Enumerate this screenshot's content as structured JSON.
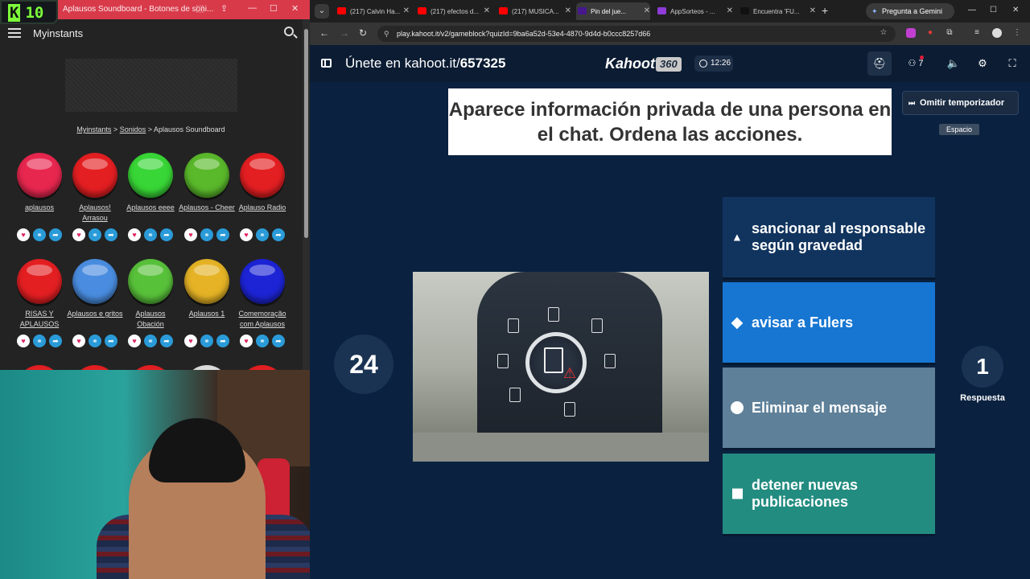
{
  "left_window": {
    "title": "Aplausos Soundboard - Botones de soni...",
    "counter_badge": "10",
    "app_title": "Myinstants",
    "breadcrumb": {
      "home": "Myinstants",
      "sep1": ">",
      "sounds": "Sonidos",
      "sep2": ">",
      "current": "Aplausos Soundboard"
    },
    "sounds": [
      {
        "label": "aplausos",
        "color": "#e8274f"
      },
      {
        "label": "Aplausos! Arrasou",
        "color": "#e41f22"
      },
      {
        "label": "Aplausos eeee",
        "color": "#38d636"
      },
      {
        "label": "Aplausos - Cheer",
        "color": "#5ab82b"
      },
      {
        "label": "Aplauso Radio",
        "color": "#e41f22"
      },
      {
        "label": "RISAS Y APLAUSOS",
        "color": "#e41f22"
      },
      {
        "label": "Aplausos e gritos",
        "color": "#4a8de0"
      },
      {
        "label": "Aplausos Obación",
        "color": "#58c13a"
      },
      {
        "label": "Aplausos 1",
        "color": "#e5b325"
      },
      {
        "label": "Comemoração com Aplausos",
        "color": "#1d24d6"
      }
    ]
  },
  "browser": {
    "tabs": [
      {
        "label": "(217) Calvin Ha...",
        "icon_color": "#ff0000"
      },
      {
        "label": "(217) efectos d...",
        "icon_color": "#ff0000"
      },
      {
        "label": "(217) MUSICA...",
        "icon_color": "#ff0000"
      },
      {
        "label": "Pin del jue...",
        "icon_color": "#46178f"
      },
      {
        "label": "AppSorteos - ...",
        "icon_color": "#8e3bd8"
      },
      {
        "label": "Encuentra 'FU...",
        "icon_color": "#111111"
      }
    ],
    "gemini_button": "Pregunta a Gemini",
    "url": "play.kahoot.it/v2/gameblock?quizId=9ba6a52d-53e4-4870-9d4d-b0ccc8257d66"
  },
  "kahoot": {
    "join_prefix": "Únete en kahoot.it/",
    "pin": "657325",
    "logo": "Kahoot!",
    "logo_badge": "360",
    "clock": "12:26",
    "players_count": "7",
    "question": "Aparece información privada de una persona en el chat. Ordena las acciones.",
    "skip_button": "Omitir temporizador",
    "skip_shortcut": "Espacio",
    "countdown": "24",
    "answers_count": "1",
    "answers_label": "Respuesta",
    "answers": [
      {
        "text": "sancionar al responsable según gravedad",
        "shape": "triangle-icon"
      },
      {
        "text": "avisar a Fulers",
        "shape": "diamond-icon"
      },
      {
        "text": "Eliminar el mensaje",
        "shape": "circle-icon"
      },
      {
        "text": "detener nuevas publicaciones",
        "shape": "square-icon"
      }
    ],
    "colors": {
      "red": "#e21b3c",
      "blue": "#1776d2",
      "teal": "#238c80",
      "navy": "#11345e"
    }
  }
}
